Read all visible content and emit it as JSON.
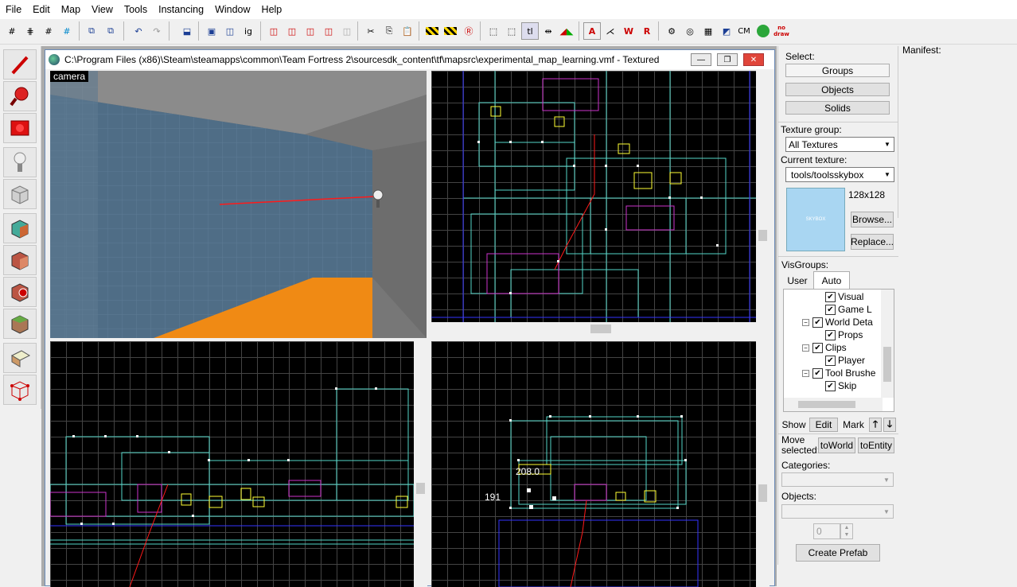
{
  "menu": [
    "File",
    "Edit",
    "Map",
    "View",
    "Tools",
    "Instancing",
    "Window",
    "Help"
  ],
  "toolbar": {
    "icons": [
      "grid-toggle",
      "grid-smaller",
      "grid-larger",
      "grid-3d",
      "carve",
      "hollow",
      "undo",
      "redo",
      "texture-lock",
      "group",
      "ungroup",
      "ignore-group",
      "hide",
      "show",
      "show-all",
      "vis-hide",
      "cut",
      "copy",
      "paste",
      "toggle-helpers",
      "toggle-models",
      "run-map",
      "select-box",
      "select-nothing",
      "tie-to-entity",
      "move-to-world",
      "flip",
      "brush-select",
      "tools-a",
      "tools-b",
      "tools-c",
      "tools-d",
      "sound",
      "camera",
      "cubemap",
      "cm",
      "game",
      "no-draw"
    ],
    "cm_label": "CM",
    "nodraw_label": "no draw"
  },
  "left_tools": [
    "selection-tool",
    "magnify-tool",
    "camera-tool",
    "entity-tool",
    "block-tool",
    "texture-tool",
    "apply-texture-tool",
    "decal-tool",
    "overlay-tool",
    "clipping-tool",
    "vertex-tool"
  ],
  "window": {
    "title": "C:\\Program Files (x86)\\Steam\\steamapps\\common\\Team Fortress 2\\sourcesdk_content\\tf\\mapsrc\\experimental_map_learning.vmf - Textured"
  },
  "viewports": {
    "camera_label": "camera",
    "coord_a": "208.0",
    "coord_b": "191"
  },
  "select_panel": {
    "label": "Select:",
    "groups": "Groups",
    "objects": "Objects",
    "solids": "Solids"
  },
  "texture_panel": {
    "group_label": "Texture group:",
    "group_value": "All Textures",
    "current_label": "Current texture:",
    "current_value": "tools/toolsskybox",
    "size": "128x128",
    "preview_text": "SKYBOX",
    "browse": "Browse...",
    "replace": "Replace..."
  },
  "visgroups": {
    "label": "VisGroups:",
    "tabs": [
      "User",
      "Auto"
    ],
    "items": [
      {
        "label": "Visual",
        "level": 2,
        "expander": false
      },
      {
        "label": "Game L",
        "level": 2,
        "expander": false
      },
      {
        "label": "World Deta",
        "level": 1,
        "expander": true
      },
      {
        "label": "Props",
        "level": 2,
        "expander": false
      },
      {
        "label": "Clips",
        "level": 1,
        "expander": true
      },
      {
        "label": "Player",
        "level": 2,
        "expander": false
      },
      {
        "label": "Tool Brushe",
        "level": 1,
        "expander": true
      },
      {
        "label": "Skip",
        "level": 2,
        "expander": false
      }
    ],
    "show": "Show",
    "edit": "Edit",
    "mark": "Mark"
  },
  "move_panel": {
    "label": "Move selected:",
    "to_world": "toWorld",
    "to_entity": "toEntity"
  },
  "prefab_panel": {
    "categories_label": "Categories:",
    "objects_label": "Objects:",
    "count": "0",
    "create": "Create Prefab"
  },
  "manifest": {
    "label": "Manifest:"
  },
  "colors": {
    "accent_blue": "#0078d7",
    "wall_blue": "#4f6d86",
    "floor_orange": "#f08a14",
    "wire_cyan": "#55d6c8",
    "wire_yellow": "#ffff33",
    "wire_magenta": "#cc33cc",
    "wire_blue": "#3333ff",
    "path_red": "#ff1a1a"
  }
}
